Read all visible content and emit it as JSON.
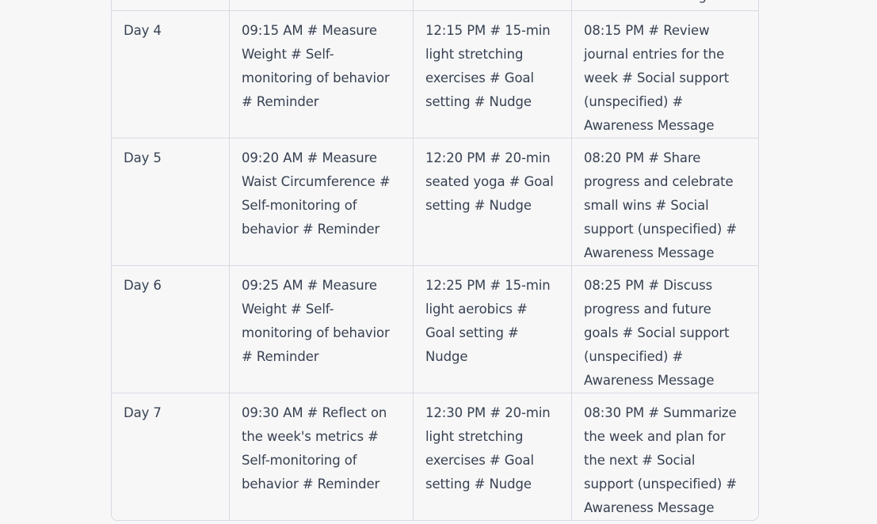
{
  "table": {
    "cut_top_text": "Awareness Message",
    "rows": [
      {
        "day": "Day 4",
        "morning": "09:15 AM # Measure Weight # Self-monitoring of behavior # Reminder",
        "noon": "12:15 PM # 15-min light stretching exercises # Goal setting # Nudge",
        "evening": "08:15 PM # Review journal entries for the week # Social support (unspecified) # Awareness Message"
      },
      {
        "day": "Day 5",
        "morning": "09:20 AM # Measure Waist Circumference # Self-monitoring of behavior # Reminder",
        "noon": "12:20 PM # 20-min seated yoga # Goal setting # Nudge",
        "evening": "08:20 PM # Share progress and celebrate small wins # Social support (unspecified) # Awareness Message"
      },
      {
        "day": "Day 6",
        "morning": "09:25 AM # Measure Weight # Self-monitoring of behavior # Reminder",
        "noon": "12:25 PM # 15-min light aerobics # Goal setting # Nudge",
        "evening": "08:25 PM # Discuss progress and future goals # Social support (unspecified) # Awareness Message"
      },
      {
        "day": "Day 7",
        "morning": "09:30 AM # Reflect on the week's metrics # Self-monitoring of behavior # Reminder",
        "noon": "12:30 PM # 20-min light stretching exercises # Goal setting # Nudge",
        "evening": "08:30 PM # Summarize the week and plan for the next # Social support (unspecified) # Awareness Message"
      }
    ]
  }
}
